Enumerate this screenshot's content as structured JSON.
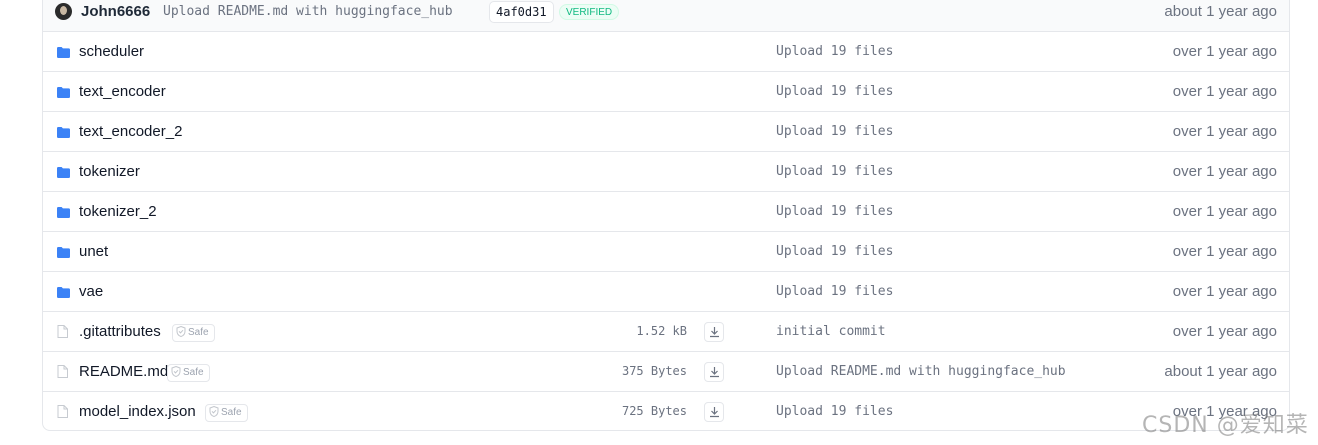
{
  "commit": {
    "author": "John6666",
    "message": "Upload README.md with huggingface_hub",
    "hash": "4af0d31",
    "verified": "VERIFIED",
    "date": "about 1 year ago"
  },
  "colors": {
    "folder": "#3b82f6",
    "verified": "#10b981",
    "muted": "#6b7280"
  },
  "files": [
    {
      "type": "folder",
      "name": "scheduler",
      "commit": "Upload 19 files",
      "date": "over 1 year ago"
    },
    {
      "type": "folder",
      "name": "text_encoder",
      "commit": "Upload 19 files",
      "date": "over 1 year ago"
    },
    {
      "type": "folder",
      "name": "text_encoder_2",
      "commit": "Upload 19 files",
      "date": "over 1 year ago"
    },
    {
      "type": "folder",
      "name": "tokenizer",
      "commit": "Upload 19 files",
      "date": "over 1 year ago"
    },
    {
      "type": "folder",
      "name": "tokenizer_2",
      "commit": "Upload 19 files",
      "date": "over 1 year ago"
    },
    {
      "type": "folder",
      "name": "unet",
      "commit": "Upload 19 files",
      "date": "over 1 year ago"
    },
    {
      "type": "folder",
      "name": "vae",
      "commit": "Upload 19 files",
      "date": "over 1 year ago"
    },
    {
      "type": "file",
      "name": ".gitattributes",
      "safe": "Safe",
      "size": "1.52 kB",
      "commit": "initial commit",
      "date": "over 1 year ago"
    },
    {
      "type": "file",
      "name": "README.md",
      "safe": "Safe",
      "size": "375 Bytes",
      "commit": "Upload README.md with huggingface_hub",
      "date": "about 1 year ago"
    },
    {
      "type": "file",
      "name": "model_index.json",
      "safe": "Safe",
      "size": "725 Bytes",
      "commit": "Upload 19 files",
      "date": "over 1 year ago"
    }
  ],
  "watermark": "CSDN @爱知菜"
}
